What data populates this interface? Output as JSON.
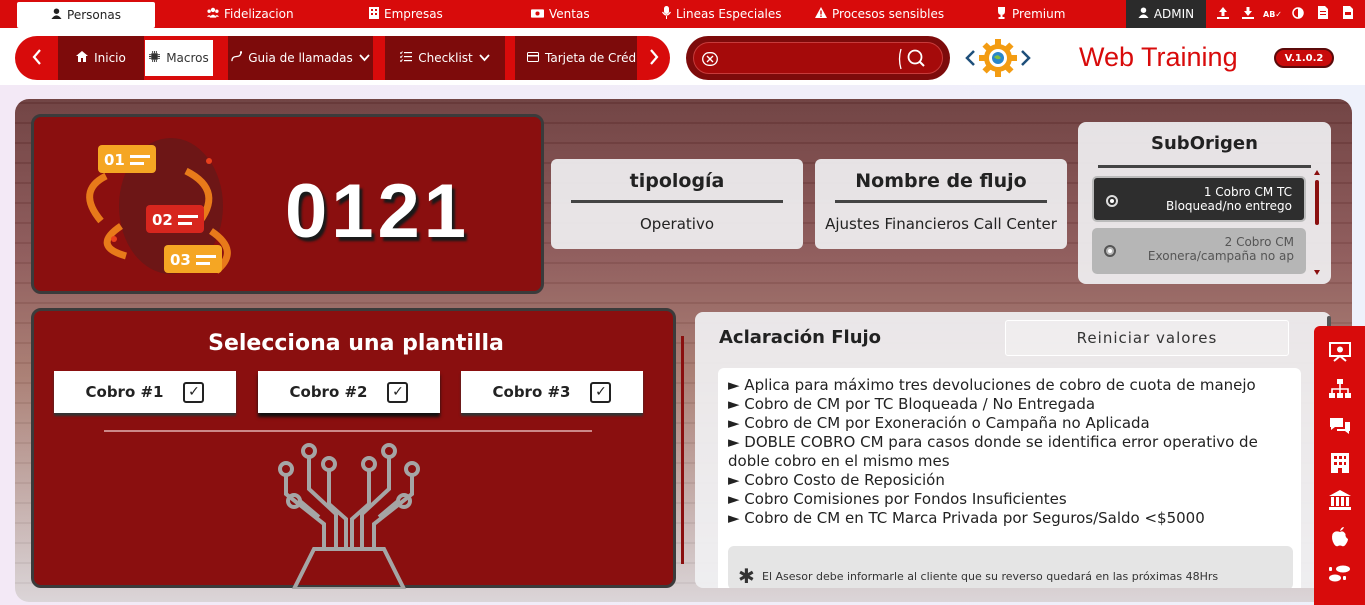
{
  "topnav": {
    "items": [
      {
        "label": "Personas",
        "icon": "person-icon"
      },
      {
        "label": "Fidelizacion",
        "icon": "group-icon"
      },
      {
        "label": "Empresas",
        "icon": "building-icon"
      },
      {
        "label": "Ventas",
        "icon": "money-icon"
      },
      {
        "label": "Lineas Especiales",
        "icon": "microphone-icon"
      },
      {
        "label": "Procesos sensibles",
        "icon": "warning-icon"
      },
      {
        "label": "Premium",
        "icon": "trophy-icon"
      }
    ],
    "user": "ADMIN"
  },
  "subnav": {
    "items": [
      "Inicio",
      "Macros",
      "Guia de llamadas",
      "Checklist",
      "Tarjeta de Crédito"
    ]
  },
  "search": {
    "value": "",
    "placeholder": ""
  },
  "brand": {
    "title": "Web Training",
    "version": "V.1.0.2"
  },
  "code": {
    "number": "0121"
  },
  "tipologia": {
    "heading": "tipología",
    "value": "Operativo"
  },
  "flujo": {
    "heading": "Nombre de flujo",
    "value": "Ajustes Financieros Call Center"
  },
  "suborigen": {
    "title": "SubOrigen",
    "options": [
      {
        "line1": "1 Cobro CM TC",
        "line2": "Bloquead/no entrego",
        "selected": true
      },
      {
        "line1": "2 Cobro CM",
        "line2": "Exonera/campaña no ap",
        "selected": false
      }
    ]
  },
  "plantilla": {
    "title": "Selecciona una plantilla",
    "buttons": [
      "Cobro #1",
      "Cobro #2",
      "Cobro #3"
    ]
  },
  "aclaracion": {
    "title": "Aclaración Flujo",
    "reset_label": "Reiniciar valores",
    "items": [
      "► Aplica para máximo tres devoluciones de cobro de cuota de manejo",
      "► Cobro de CM por TC Bloqueada / No Entregada",
      "► Cobro de CM por Exoneración o Campaña no Aplicada",
      "► DOBLE COBRO CM para casos donde se identifica error operativo de doble cobro en el mismo mes",
      "► Cobro Costo de Reposición",
      "► Cobro Comisiones por Fondos Insuficientes",
      "► Cobro de CM en TC Marca Privada por Seguros/Saldo <$5000"
    ],
    "note": "El Asesor debe informarle al cliente que su reverso quedará en las próximas 48Hrs"
  },
  "colors": {
    "brand_red": "#d80b0b",
    "dark_red": "#8a0f0f",
    "accent_dark": "#2b2b2b"
  }
}
